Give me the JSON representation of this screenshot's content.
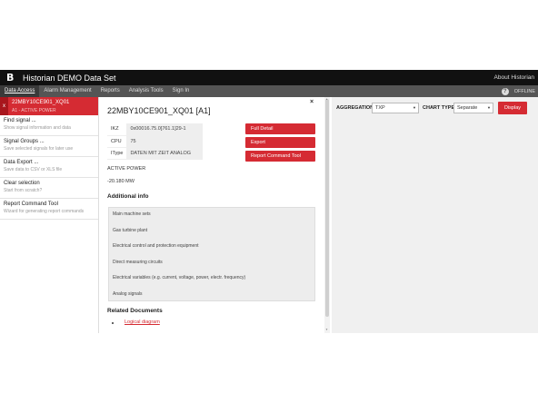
{
  "app": {
    "title": "Historian DEMO Data Set",
    "logo": "B",
    "about": "About Historian"
  },
  "nav": {
    "items": [
      "Data Access",
      "Alarm Management",
      "Reports",
      "Analysis Tools",
      "Sign In"
    ],
    "help_glyph": "?",
    "status": "OFFLINE"
  },
  "sidebar": {
    "selected": {
      "close": "x",
      "name": "22MBY10CE901_XQ01",
      "sub": "A1 - ACTIVE POWER"
    },
    "items": [
      {
        "title": "Find signal ...",
        "sub": "Show signal information and data"
      },
      {
        "title": "Signal Groups ...",
        "sub": "Save selected signals for later use"
      },
      {
        "title": "Data Export ...",
        "sub": "Save data to CSV or XLS file"
      },
      {
        "title": "Clear selection",
        "sub": "Start from scratch?"
      },
      {
        "title": "Report Command Tool",
        "sub": "Wizard for generating report commands"
      }
    ]
  },
  "detail": {
    "close": "×",
    "title": "22MBY10CE901_XQ01 [A1]",
    "fields": [
      {
        "key": "IKZ",
        "value": "0x00016.75.0[761.1]29-1"
      },
      {
        "key": "CPU",
        "value": "75"
      },
      {
        "key": "IType",
        "value": "DATEN MIT ZEIT ANALOG"
      }
    ],
    "buttons": {
      "full_detail": "Full Detail",
      "export": "Export",
      "report_tool": "Report Command Tool"
    },
    "signal_label": "ACTIVE POWER",
    "signal_value": "-20.180 MW",
    "additional_title": "Additional info",
    "additional_lines": [
      "Main machine sets",
      "Gas turbine plant",
      "Electrical control and protection equipment",
      "Direct measuring circuits",
      "Electrical variables (e.g. current, voltage, power, electr. frequency)",
      "Analog signals"
    ],
    "related_title": "Related Documents",
    "related_link": "Logical diagram"
  },
  "chart_controls": {
    "aggregation_label": "AGGREGATION",
    "aggregation_value": "TXP",
    "chart_type_label": "CHART TYPE",
    "chart_type_value": "Separate",
    "display_label": "Display"
  }
}
